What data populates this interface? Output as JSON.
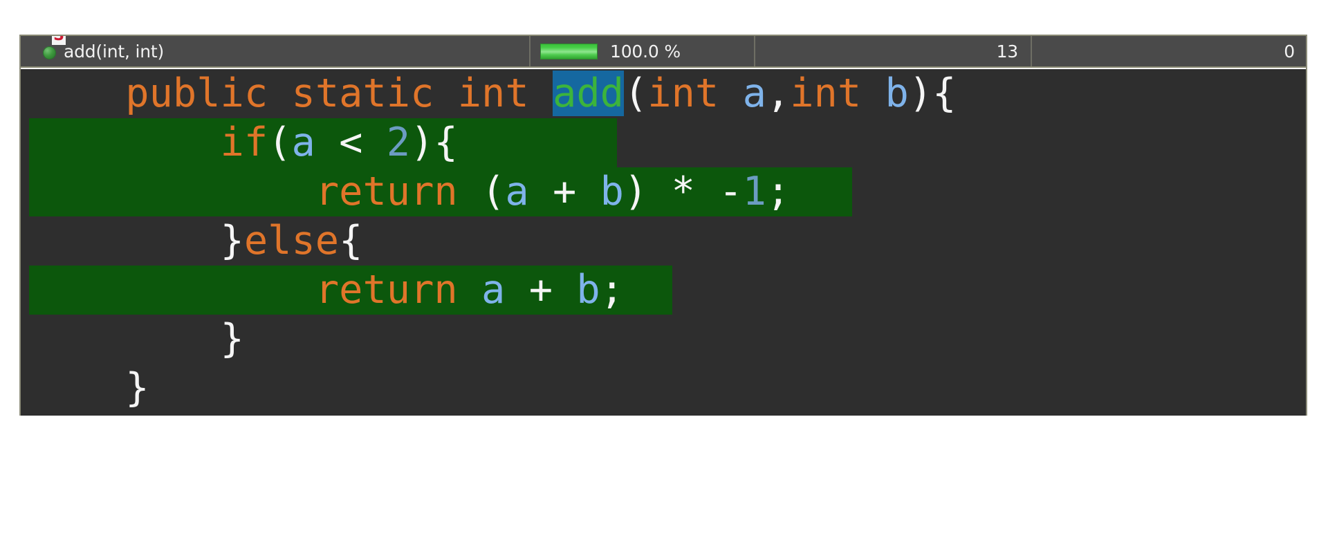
{
  "header": {
    "method_icon": "green-ball-static-method-icon",
    "static_badge": "S",
    "method_name": "add(int, int)",
    "coverage_bar_icon": "coverage-progress-bar",
    "coverage_percent": "100.0 %",
    "covered_count": "13",
    "uncovered_count": "0"
  },
  "code": {
    "lines": [
      {
        "covered": false,
        "stripe_width": 0,
        "tokens": [
          {
            "t": "    ",
            "c": "pun"
          },
          {
            "t": "public static int ",
            "c": "kw"
          },
          {
            "t": "add",
            "c": "sel"
          },
          {
            "t": "(",
            "c": "pun"
          },
          {
            "t": "int ",
            "c": "kw"
          },
          {
            "t": "a",
            "c": "var"
          },
          {
            "t": ",",
            "c": "pun"
          },
          {
            "t": "int ",
            "c": "kw"
          },
          {
            "t": "b",
            "c": "var"
          },
          {
            "t": "){",
            "c": "pun"
          }
        ]
      },
      {
        "covered": true,
        "stripe_width": 850,
        "tokens": [
          {
            "t": "        ",
            "c": "pun"
          },
          {
            "t": "if",
            "c": "kw"
          },
          {
            "t": "(",
            "c": "pun"
          },
          {
            "t": "a",
            "c": "var"
          },
          {
            "t": " < ",
            "c": "pun"
          },
          {
            "t": "2",
            "c": "num"
          },
          {
            "t": "){",
            "c": "pun"
          }
        ]
      },
      {
        "covered": true,
        "stripe_width": 1190,
        "tokens": [
          {
            "t": "            ",
            "c": "pun"
          },
          {
            "t": "return",
            "c": "kw"
          },
          {
            "t": " (",
            "c": "pun"
          },
          {
            "t": "a",
            "c": "var"
          },
          {
            "t": " + ",
            "c": "pun"
          },
          {
            "t": "b",
            "c": "var"
          },
          {
            "t": ") * -",
            "c": "pun"
          },
          {
            "t": "1",
            "c": "num"
          },
          {
            "t": ";",
            "c": "pun"
          }
        ]
      },
      {
        "covered": false,
        "stripe_width": 0,
        "tokens": [
          {
            "t": "        }",
            "c": "pun"
          },
          {
            "t": "else",
            "c": "kw"
          },
          {
            "t": "{",
            "c": "pun"
          }
        ]
      },
      {
        "covered": true,
        "stripe_width": 930,
        "tokens": [
          {
            "t": "            ",
            "c": "pun"
          },
          {
            "t": "return",
            "c": "kw"
          },
          {
            "t": " ",
            "c": "pun"
          },
          {
            "t": "a",
            "c": "var"
          },
          {
            "t": " + ",
            "c": "pun"
          },
          {
            "t": "b",
            "c": "var"
          },
          {
            "t": ";",
            "c": "pun"
          }
        ]
      },
      {
        "covered": false,
        "stripe_width": 0,
        "tokens": [
          {
            "t": "        }",
            "c": "pun"
          }
        ]
      },
      {
        "covered": false,
        "stripe_width": 0,
        "tokens": [
          {
            "t": "    }",
            "c": "pun"
          }
        ]
      }
    ]
  }
}
